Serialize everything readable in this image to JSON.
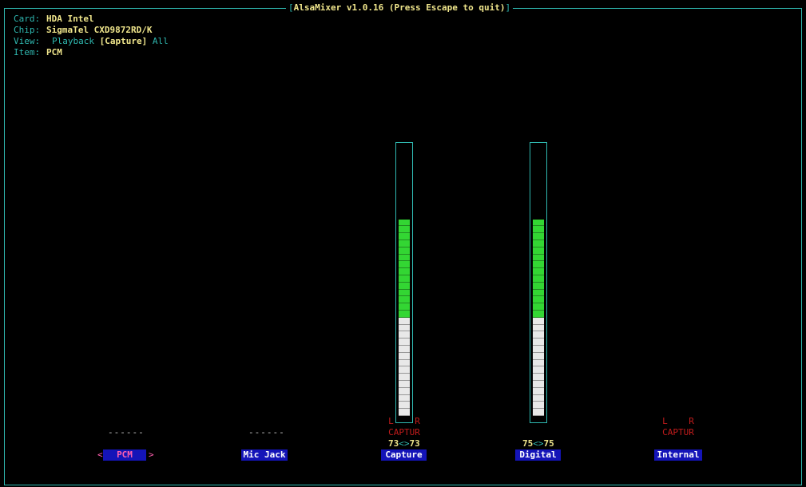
{
  "app": {
    "title": "AlsaMixer v1.0.16 (Press Escape to quit)",
    "open_bracket": "[",
    "close_bracket": "]"
  },
  "info": {
    "card_label": "Card:",
    "card_value": "HDA Intel",
    "chip_label": "Chip:",
    "chip_value": "SigmaTel CXD9872RD/K",
    "view_label": "View:",
    "view_playback": "Playback",
    "view_capture": "[Capture]",
    "view_all": "All",
    "item_label": "Item:",
    "item_value": "PCM"
  },
  "channels": [
    {
      "name": "PCM",
      "selected": true,
      "placeholder": "------",
      "sel_left": "<",
      "sel_right": ">"
    },
    {
      "name": "Mic Jack",
      "selected": false,
      "placeholder": "------"
    },
    {
      "name": "Capture",
      "selected": false,
      "lr": "L    R",
      "capture_label": "CAPTUR",
      "volume_left": "73",
      "volume_right": "73",
      "level": 0.73
    },
    {
      "name": "Digital",
      "selected": false,
      "volume_left": "75",
      "volume_right": "75",
      "level": 0.75
    },
    {
      "name": "Internal",
      "selected": false,
      "lr": "L    R",
      "capture_label": "CAPTUR"
    }
  ],
  "colors": {
    "frame": "#2fb8b0",
    "accent": "#f0e68c",
    "level_on": "#33d633",
    "level_off": "#e8e8e8",
    "capture_flag": "#c41c1c",
    "label_bg": "#1414b8"
  }
}
